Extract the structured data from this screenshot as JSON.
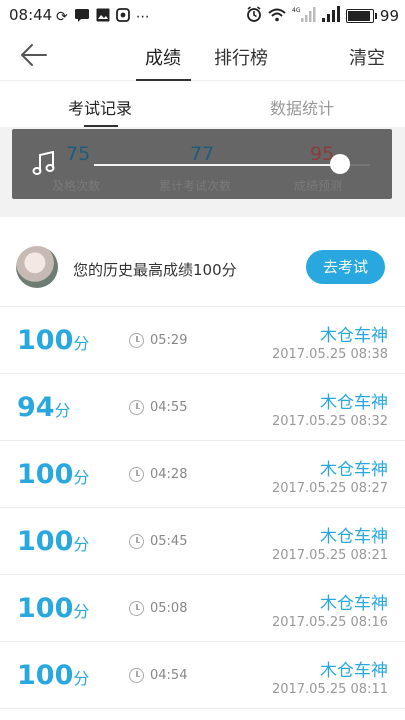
{
  "status_bar": {
    "time": "08:44",
    "left_icons": [
      "sync-icon",
      "message-icon",
      "image-icon",
      "app-icon",
      "more-icon"
    ],
    "right_icons": [
      "alarm-icon",
      "wifi-icon",
      "mobile-4g-signal-icon",
      "signal-icon",
      "battery-icon"
    ],
    "battery": "99",
    "battery_level": 0.99,
    "network_label": "4G"
  },
  "top_nav": {
    "tabs": [
      {
        "label": "成绩",
        "active": true
      },
      {
        "label": "排行榜",
        "active": false
      }
    ],
    "clear_label": "清空"
  },
  "sub_tabs": [
    {
      "label": "考试记录",
      "active": true
    },
    {
      "label": "数据统计",
      "active": false
    }
  ],
  "stats": {
    "items": [
      {
        "value": "75",
        "label": "及格次数"
      },
      {
        "value": "77",
        "label": "累计考试次数"
      },
      {
        "value": "95",
        "label": "成绩预测"
      }
    ]
  },
  "best_score": {
    "text": "您的历史最高成绩100分",
    "button_label": "去考试"
  },
  "records": [
    {
      "score": "100",
      "unit": "分",
      "duration": "05:29",
      "name": "木仓车神",
      "datetime": "2017.05.25  08:38"
    },
    {
      "score": "94",
      "unit": "分",
      "duration": "04:55",
      "name": "木仓车神",
      "datetime": "2017.05.25  08:32"
    },
    {
      "score": "100",
      "unit": "分",
      "duration": "04:28",
      "name": "木仓车神",
      "datetime": "2017.05.25  08:27"
    },
    {
      "score": "100",
      "unit": "分",
      "duration": "05:45",
      "name": "木仓车神",
      "datetime": "2017.05.25  08:21"
    },
    {
      "score": "100",
      "unit": "分",
      "duration": "05:08",
      "name": "木仓车神",
      "datetime": "2017.05.25  08:16"
    },
    {
      "score": "100",
      "unit": "分",
      "duration": "04:54",
      "name": "木仓车神",
      "datetime": "2017.05.25  08:11"
    }
  ],
  "colors": {
    "accent": "#29a8e0",
    "stat_blue": "#1e5c7e",
    "stat_red": "#8a3c3a"
  }
}
